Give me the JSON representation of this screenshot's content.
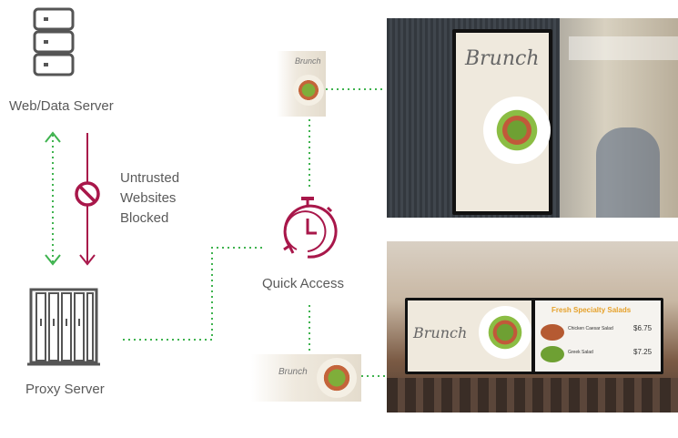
{
  "nodes": {
    "web_server": {
      "label": "Web/Data Server"
    },
    "proxy_server": {
      "label": "Proxy Server"
    },
    "blocked": {
      "lines": [
        "Untrusted",
        "Websites",
        "Blocked"
      ]
    },
    "quick_access": {
      "label": "Quick Access"
    }
  },
  "signage": {
    "top_screen_text": "Brunch",
    "menu_title": "Fresh Specialty Salads",
    "menu_items": [
      {
        "name": "Chicken Caesar Salad",
        "price": "$6.75"
      },
      {
        "name": "Greek Salad",
        "price": "$7.25"
      }
    ]
  },
  "colors": {
    "accent": "#a8174a",
    "dotted_green": "#3fb34f",
    "icon_gray": "#555555"
  },
  "icons": [
    "server-icon",
    "blocked-icon",
    "proxy-server-icon",
    "stopwatch-icon"
  ]
}
